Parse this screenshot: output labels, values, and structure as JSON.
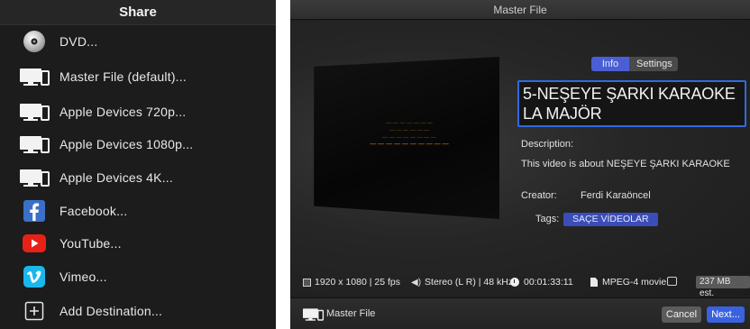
{
  "share_menu": {
    "title": "Share",
    "items": [
      {
        "label": "DVD...",
        "icon": "dvd-disc-icon"
      },
      {
        "label": "Master File (default)...",
        "icon": "devices-icon"
      },
      {
        "label": "Apple Devices 720p...",
        "icon": "devices-icon"
      },
      {
        "label": "Apple Devices 1080p...",
        "icon": "devices-icon"
      },
      {
        "label": "Apple Devices 4K...",
        "icon": "devices-icon"
      },
      {
        "label": "Facebook...",
        "icon": "facebook-icon"
      },
      {
        "label": "YouTube...",
        "icon": "youtube-icon"
      },
      {
        "label": "Vimeo...",
        "icon": "vimeo-icon"
      },
      {
        "label": "Add Destination...",
        "icon": "plus-box-icon"
      }
    ]
  },
  "master_panel": {
    "window_title": "Master File",
    "tabs": [
      "Info",
      "Settings"
    ],
    "active_tab": "Info",
    "title_value": "5-NEŞEYE ŞARKI KARAOKE LA MAJÖR",
    "description_label": "Description:",
    "description_value": "This video is about NEŞEYE ŞARKI KARAOKE",
    "creator_label": "Creator:",
    "creator_value": "Ferdi Karaöncel",
    "tags_label": "Tags:",
    "tags": [
      "SAÇE VİDEOLAR"
    ],
    "info_bar": {
      "resolution": "1920 x 1080 | 25 fps",
      "audio": "Stereo (L R) | 48 kHz",
      "duration": "00:01:33:11",
      "format": "MPEG-4 movie",
      "size": "237 MB est."
    },
    "destination_label": "Master File",
    "cancel_label": "Cancel",
    "next_label": "Next...",
    "colors": {
      "accent": "#3a62e0",
      "tag": "#3a4db8",
      "background": "#1f1f1f"
    }
  }
}
